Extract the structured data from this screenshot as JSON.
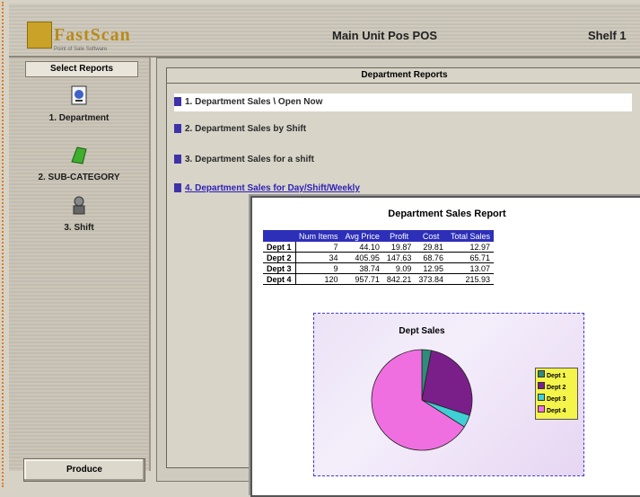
{
  "header": {
    "brand": "FastScan",
    "brand_tagline": "Point of Sale Software",
    "title": "Main Unit Pos POS",
    "shift": "Shelf 1"
  },
  "sidebar": {
    "heading": "Select Reports",
    "items": [
      {
        "label": "1. Department",
        "icon": "department-icon"
      },
      {
        "label": "2. SUB-CATEGORY",
        "icon": "category-icon"
      },
      {
        "label": "3. Shift",
        "icon": "shift-icon"
      }
    ],
    "produce_label": "Produce"
  },
  "main": {
    "panel_title": "Department Reports",
    "reports": [
      {
        "label": "1. Department Sales \\ Open Now"
      },
      {
        "label": "2. Department Sales by Shift"
      },
      {
        "label": "3. Department Sales for a shift"
      },
      {
        "label": "4. Department Sales for Day/Shift/Weekly"
      }
    ]
  },
  "report": {
    "title": "Department Sales Report",
    "columns": [
      "",
      "Num Items",
      "Avg Price",
      "Profit",
      "Cost",
      "Total Sales"
    ],
    "rows": [
      {
        "name": "Dept 1",
        "cells": [
          "7",
          "44.10",
          "19.87",
          "29.81",
          "12.97"
        ]
      },
      {
        "name": "Dept 2",
        "cells": [
          "34",
          "405.95",
          "147.63",
          "68.76",
          "65.71"
        ]
      },
      {
        "name": "Dept 3",
        "cells": [
          "9",
          "38.74",
          "9.09",
          "12.95",
          "13.07"
        ]
      },
      {
        "name": "Dept 4",
        "cells": [
          "120",
          "957.71",
          "842.21",
          "373.84",
          "215.93"
        ]
      }
    ]
  },
  "chart_data": {
    "type": "pie",
    "title": "Dept Sales",
    "categories": [
      "Dept 1",
      "Dept 2",
      "Dept 3",
      "Dept 4"
    ],
    "values": [
      3,
      27,
      4,
      66
    ],
    "colors": [
      "#2f8b7a",
      "#7a1f8a",
      "#3fd0d6",
      "#f06fe0"
    ],
    "legend": "right"
  }
}
